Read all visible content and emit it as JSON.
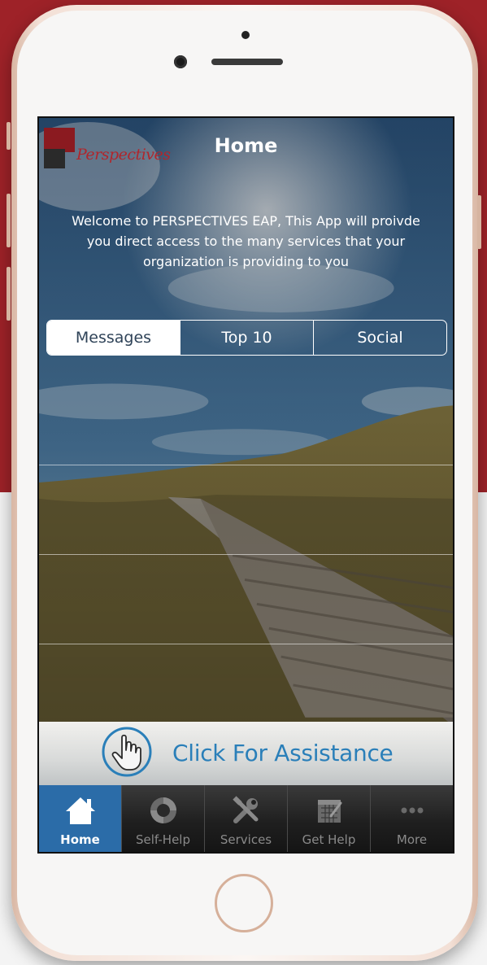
{
  "header": {
    "title": "Home"
  },
  "brand": {
    "logo_text": "Perspectives"
  },
  "welcome": {
    "line1": "Welcome to PERSPECTIVES EAP, This App will proivde",
    "line2": "you direct access to the many services that your",
    "line3": "organization is providing to you"
  },
  "tabs": [
    {
      "label": "Messages",
      "selected": true
    },
    {
      "label": "Top 10",
      "selected": false
    },
    {
      "label": "Social",
      "selected": false
    }
  ],
  "assist": {
    "label": "Click For Assistance",
    "icon": "hand-pointer-icon"
  },
  "tabbar": [
    {
      "label": "Home",
      "icon": "house-icon",
      "active": true
    },
    {
      "label": "Self-Help",
      "icon": "lifebuoy-icon",
      "active": false
    },
    {
      "label": "Services",
      "icon": "tools-icon",
      "active": false
    },
    {
      "label": "Get Help",
      "icon": "calendar-icon",
      "active": false
    },
    {
      "label": "More",
      "icon": "more-dots-icon",
      "active": false
    }
  ],
  "colors": {
    "brand_red": "#9e2228",
    "tab_active": "#2b6ca8",
    "assist_blue": "#2a7fb9"
  }
}
